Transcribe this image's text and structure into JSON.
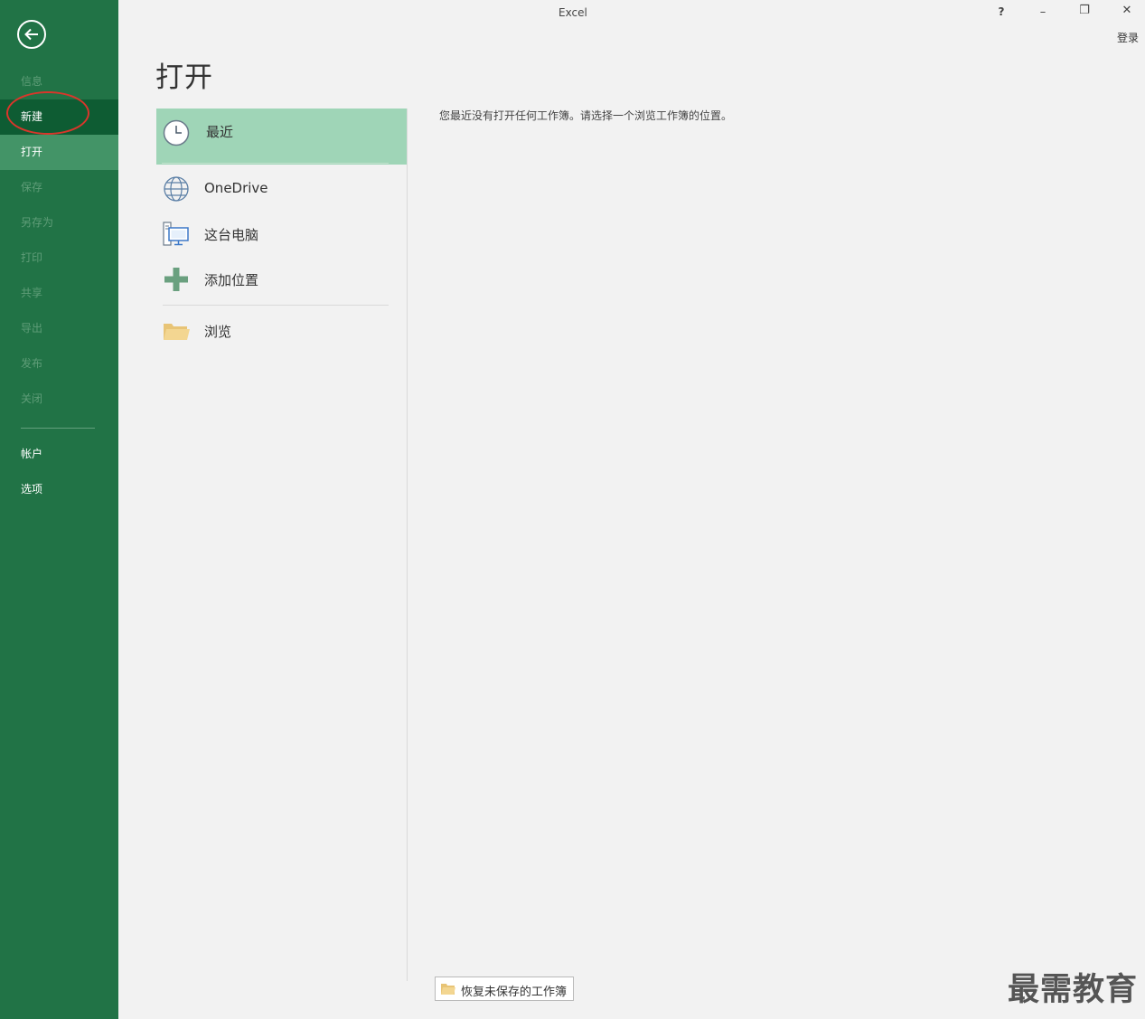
{
  "window": {
    "title": "Excel",
    "controls": {
      "help": "?",
      "minimize": "–",
      "restore": "❐",
      "close": "✕"
    },
    "signin": "登录"
  },
  "sidebar": {
    "items": [
      {
        "label": "信息",
        "enabled": false
      },
      {
        "label": "新建",
        "enabled": true,
        "state": "hover"
      },
      {
        "label": "打开",
        "enabled": true,
        "state": "selected"
      },
      {
        "label": "保存",
        "enabled": false
      },
      {
        "label": "另存为",
        "enabled": false
      },
      {
        "label": "打印",
        "enabled": false
      },
      {
        "label": "共享",
        "enabled": false
      },
      {
        "label": "导出",
        "enabled": false
      },
      {
        "label": "发布",
        "enabled": false
      },
      {
        "label": "关闭",
        "enabled": false
      }
    ],
    "bottom_items": [
      {
        "label": "帐户"
      },
      {
        "label": "选项"
      }
    ]
  },
  "page": {
    "title": "打开",
    "locations": [
      {
        "label": "最近",
        "icon": "clock-icon",
        "selected": true
      },
      {
        "label": "OneDrive",
        "icon": "globe-icon"
      },
      {
        "label": "这台电脑",
        "icon": "computer-icon"
      },
      {
        "label": "添加位置",
        "icon": "plus-icon"
      },
      {
        "label": "浏览",
        "icon": "folder-icon"
      }
    ],
    "empty_message": "您最近没有打开任何工作簿。请选择一个浏览工作簿的位置。",
    "recover_button": "恢复未保存的工作簿"
  },
  "watermark": "最需教育",
  "colors": {
    "sidebar": "#217346",
    "selected_nav": "#439467",
    "hover_nav": "#0e5c33",
    "selected_location": "#9fd5b7",
    "annotation": "#d9362b"
  }
}
